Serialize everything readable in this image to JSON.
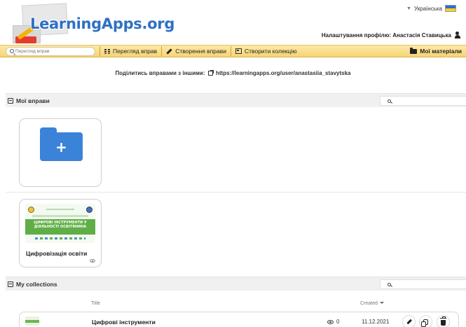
{
  "header": {
    "logo_text": "LearningApps.org",
    "language": "Українська",
    "profile_label": "Налаштування профілю: Анастасія Ставицька"
  },
  "navbar": {
    "search_placeholder": "Перегляд вправ",
    "items": [
      {
        "label": "Перегляд вправ",
        "icon": "grid-icon"
      },
      {
        "label": "Створення вправи",
        "icon": "pencil-icon"
      },
      {
        "label": "Створити колекцію",
        "icon": "collection-icon"
      }
    ],
    "my_materials": "Мої матеріали",
    "bar_color": "#f6d474"
  },
  "share": {
    "label": "Поділитись вправами з іншими:",
    "url": "https://learningapps.org/user/anastasiia_stavytska"
  },
  "my_exercises": {
    "title": "Мої вправи",
    "folder_color": "#3b83d8",
    "items": [
      {
        "title": "Цифровізація освіти",
        "thumb_text": "ЦИФРОВІ ІНСТРУМЕНТИ У ДІЯЛЬНОСТІ ОСВІТЯНИНА"
      }
    ]
  },
  "collections": {
    "title": "My collections",
    "col_title": "Title",
    "col_created": "Created",
    "rows": [
      {
        "title": "Цифрові інструменти",
        "views": "0",
        "created": "11.12.2021"
      }
    ]
  }
}
